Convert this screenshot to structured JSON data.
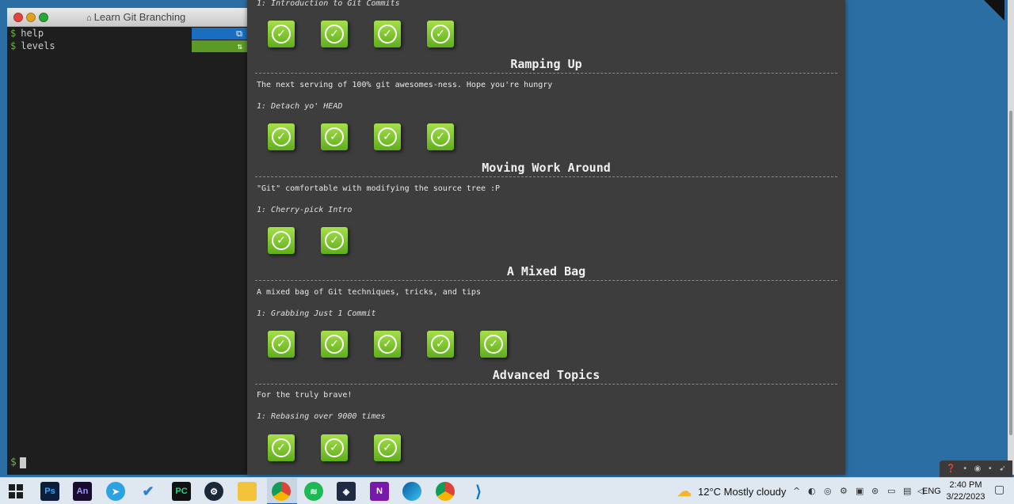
{
  "terminal": {
    "title": "Learn Git Branching",
    "lines": [
      "help",
      "levels"
    ],
    "side_icons": [
      "⧉",
      "⇅"
    ]
  },
  "dialog": {
    "top_partial_subtitle": "1: Introduction to Git Commits",
    "sequences": [
      {
        "title": "Ramping Up",
        "about": "The next serving of 100% git awesomes-ness. Hope you're hungry",
        "sub": "1: Detach yo' HEAD",
        "levels": 4
      },
      {
        "title": "Moving Work Around",
        "about": "\"Git\" comfortable with modifying the source tree :P",
        "sub": "1: Cherry-pick Intro",
        "levels": 2
      },
      {
        "title": "A Mixed Bag",
        "about": "A mixed bag of Git techniques, tricks, and tips",
        "sub": "1: Grabbing Just 1 Commit",
        "levels": 5
      },
      {
        "title": "Advanced Topics",
        "about": "For the truly brave!",
        "sub": "1: Rebasing over 9000 times",
        "levels": 3
      }
    ]
  },
  "taskbar": {
    "apps": [
      "Ps",
      "An",
      "PC"
    ],
    "weather": "12°C  Mostly cloudy",
    "lang": "ENG",
    "time": "2:40 PM",
    "date": "3/22/2023"
  },
  "colors": {
    "accent": "#0a63c7",
    "level_green": "#7cc62c",
    "desktop": "#2b6ea3"
  }
}
